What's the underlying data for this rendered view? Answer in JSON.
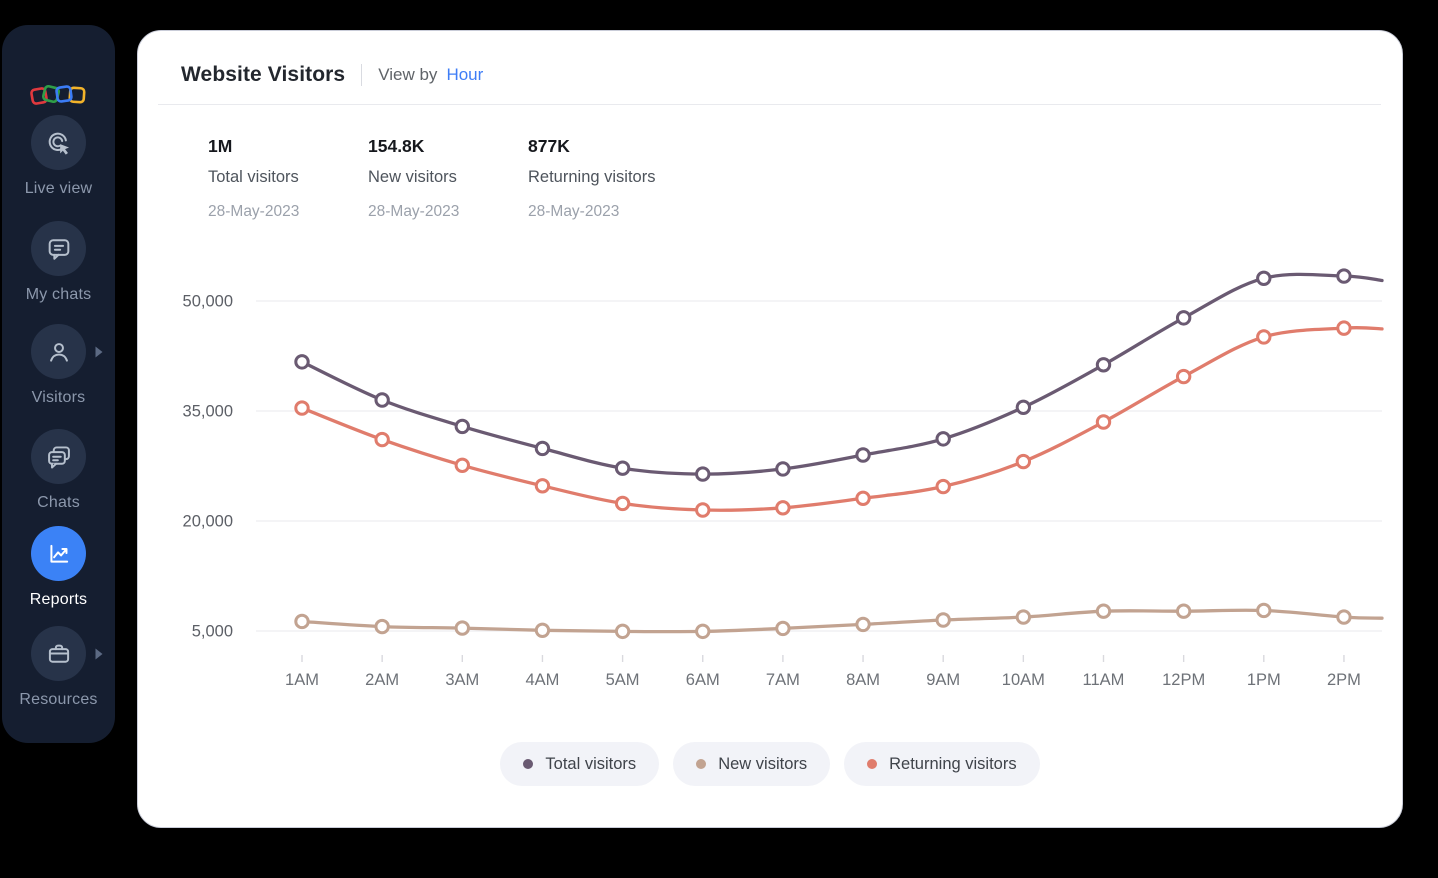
{
  "colors": {
    "background": "#000000",
    "sidebar_bg": "#151e30",
    "sidebar_circle_bg": "#273349",
    "accent_blue": "#3b82f6",
    "link_blue": "#3e7df6",
    "series_total": "#6a5a72",
    "series_new": "#c2a391",
    "series_returning": "#e07c6c"
  },
  "sidebar": {
    "logo": {
      "name": "four-squares-logo",
      "square_colors": [
        "#e0393e",
        "#2f9e48",
        "#3b7cf6",
        "#f2b32a"
      ]
    },
    "items": [
      {
        "label": "Live view",
        "icon": "live-view-icon",
        "active": false,
        "chevron": false
      },
      {
        "label": "My chats",
        "icon": "my-chats-icon",
        "active": false,
        "chevron": false
      },
      {
        "label": "Visitors",
        "icon": "visitors-icon",
        "active": false,
        "chevron": true
      },
      {
        "label": "Chats",
        "icon": "chats-icon",
        "active": false,
        "chevron": false
      },
      {
        "label": "Reports",
        "icon": "reports-icon",
        "active": true,
        "chevron": false
      },
      {
        "label": "Resources",
        "icon": "resources-icon",
        "active": false,
        "chevron": true
      }
    ]
  },
  "header": {
    "title": "Website Visitors",
    "view_by_label": "View by",
    "view_by_value": "Hour"
  },
  "stats": [
    {
      "value": "1M",
      "label": "Total visitors",
      "date": "28-May-2023"
    },
    {
      "value": "154.8K",
      "label": "New visitors",
      "date": "28-May-2023"
    },
    {
      "value": "877K",
      "label": "Returning visitors",
      "date": "28-May-2023"
    }
  ],
  "chart_data": {
    "type": "line",
    "title": "Website Visitors by Hour",
    "categories": [
      "1AM",
      "2AM",
      "3AM",
      "4AM",
      "5AM",
      "6AM",
      "7AM",
      "8AM",
      "9AM",
      "10AM",
      "11AM",
      "12PM",
      "1PM",
      "2PM"
    ],
    "series": [
      {
        "name": "Total visitors",
        "color": "#6a5a72",
        "values": [
          41700,
          36500,
          32900,
          29900,
          27200,
          26400,
          27100,
          29000,
          31200,
          35500,
          41300,
          47700,
          53100,
          53400
        ],
        "tail_value": 52800
      },
      {
        "name": "New visitors",
        "color": "#c2a391",
        "values": [
          6300,
          5600,
          5400,
          5100,
          4950,
          4950,
          5350,
          5900,
          6500,
          6900,
          7700,
          7700,
          7800,
          6900
        ],
        "tail_value": 6750
      },
      {
        "name": "Returning visitors",
        "color": "#e07c6c",
        "values": [
          35400,
          31100,
          27600,
          24800,
          22400,
          21500,
          21800,
          23100,
          24700,
          28100,
          33500,
          39700,
          45100,
          46300
        ],
        "tail_value": 46200
      }
    ],
    "y_ticks": [
      {
        "value": 50000,
        "label": "50,000"
      },
      {
        "value": 35000,
        "label": "35,000"
      },
      {
        "value": 20000,
        "label": "20,000"
      },
      {
        "value": 5000,
        "label": "5,000"
      }
    ],
    "ylim": [
      5000,
      55000
    ],
    "grid": "horizontal",
    "legend_position": "bottom",
    "marker": "open-circle"
  }
}
